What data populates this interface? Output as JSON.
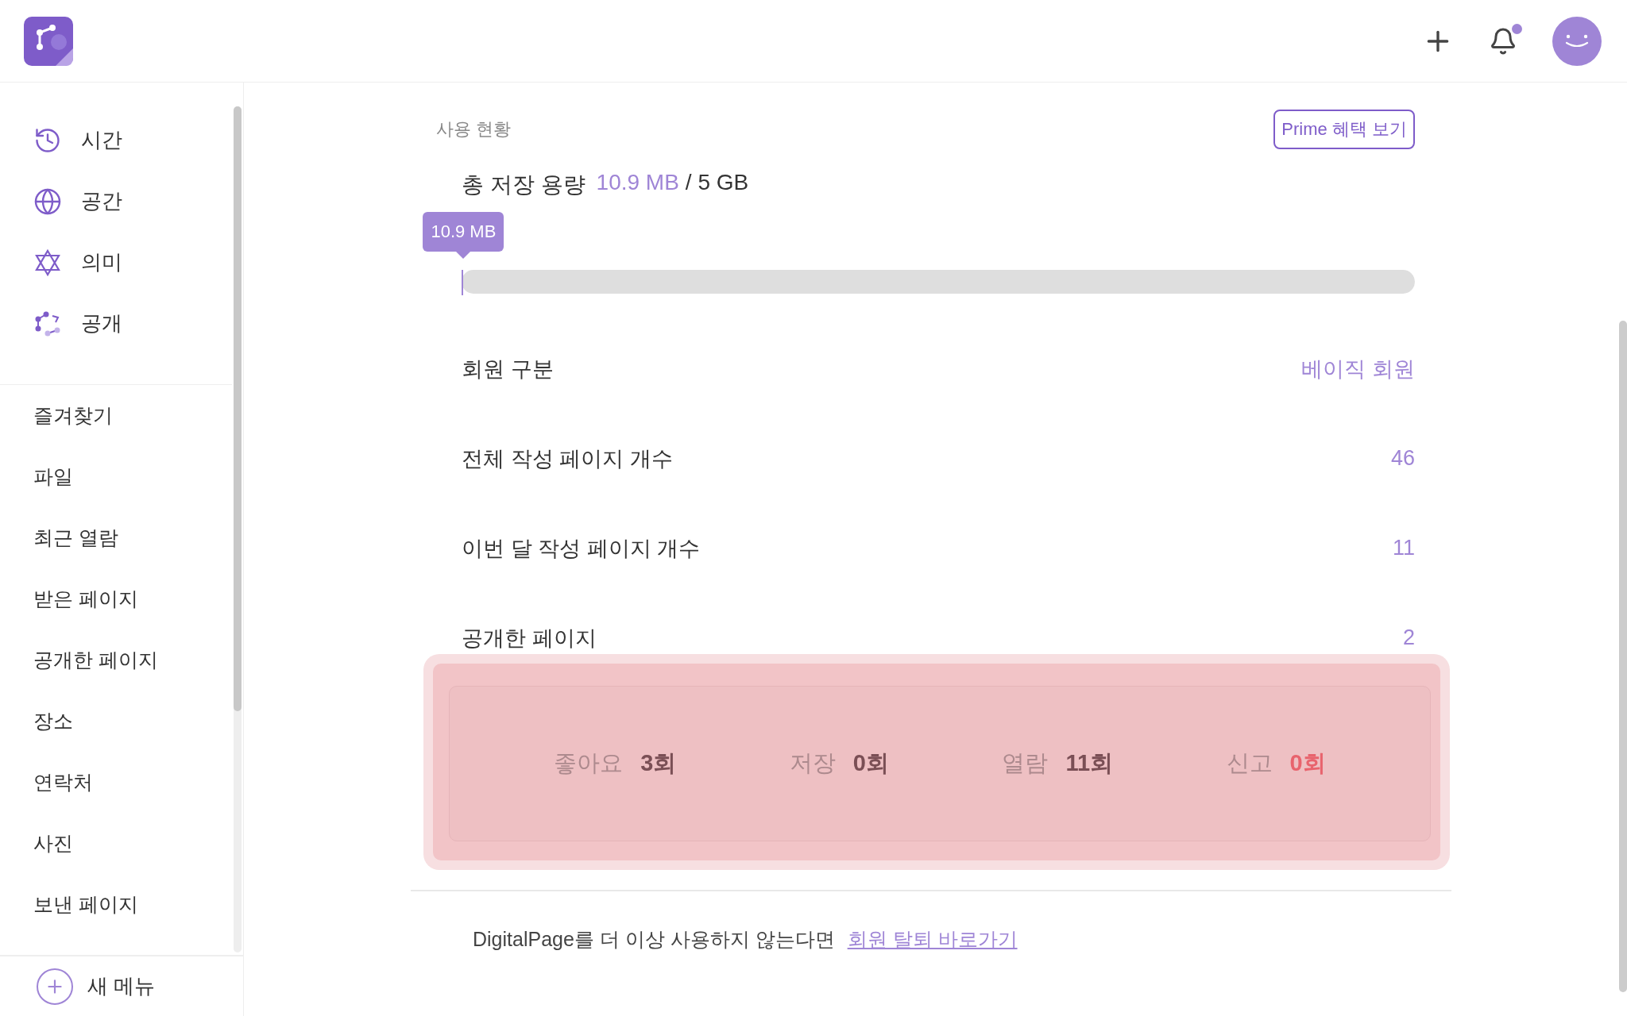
{
  "header": {
    "notification_dot": true
  },
  "sidebar": {
    "nav": [
      {
        "label": "시간",
        "kind": "time"
      },
      {
        "label": "공간",
        "kind": "space"
      },
      {
        "label": "의미",
        "kind": "meaning"
      },
      {
        "label": "공개",
        "kind": "public"
      }
    ],
    "menu": [
      "즐겨찾기",
      "파일",
      "최근 열람",
      "받은 페이지",
      "공개한 페이지",
      "장소",
      "연락처",
      "사진",
      "보낸 페이지"
    ],
    "new_menu": "새 메뉴"
  },
  "usage": {
    "title": "사용 현황",
    "prime_button": "Prime 혜택 보기",
    "storage": {
      "label": "총 저장 용량",
      "used": "10.9 MB",
      "total": "/ 5 GB",
      "tooltip": "10.9 MB",
      "level": 0.002
    },
    "rows": [
      {
        "label": "회원 구분",
        "value": "베이직 회원"
      },
      {
        "label": "전체 작성 페이지 개수",
        "value": "46"
      },
      {
        "label": "이번 달 작성 페이지 개수",
        "value": "11"
      },
      {
        "label": "공개한 페이지",
        "value": "2"
      }
    ],
    "stats": [
      {
        "label": "좋아요",
        "value": "3회",
        "kind": "normal"
      },
      {
        "label": "저장",
        "value": "0회",
        "kind": "normal"
      },
      {
        "label": "열람",
        "value": "11회",
        "kind": "normal"
      },
      {
        "label": "신고",
        "value": "0회",
        "kind": "alert"
      }
    ]
  },
  "footer": {
    "text": "DigitalPage를 더 이상 사용하지 않는다면",
    "link": "회원 탈퇴 바로가기"
  }
}
